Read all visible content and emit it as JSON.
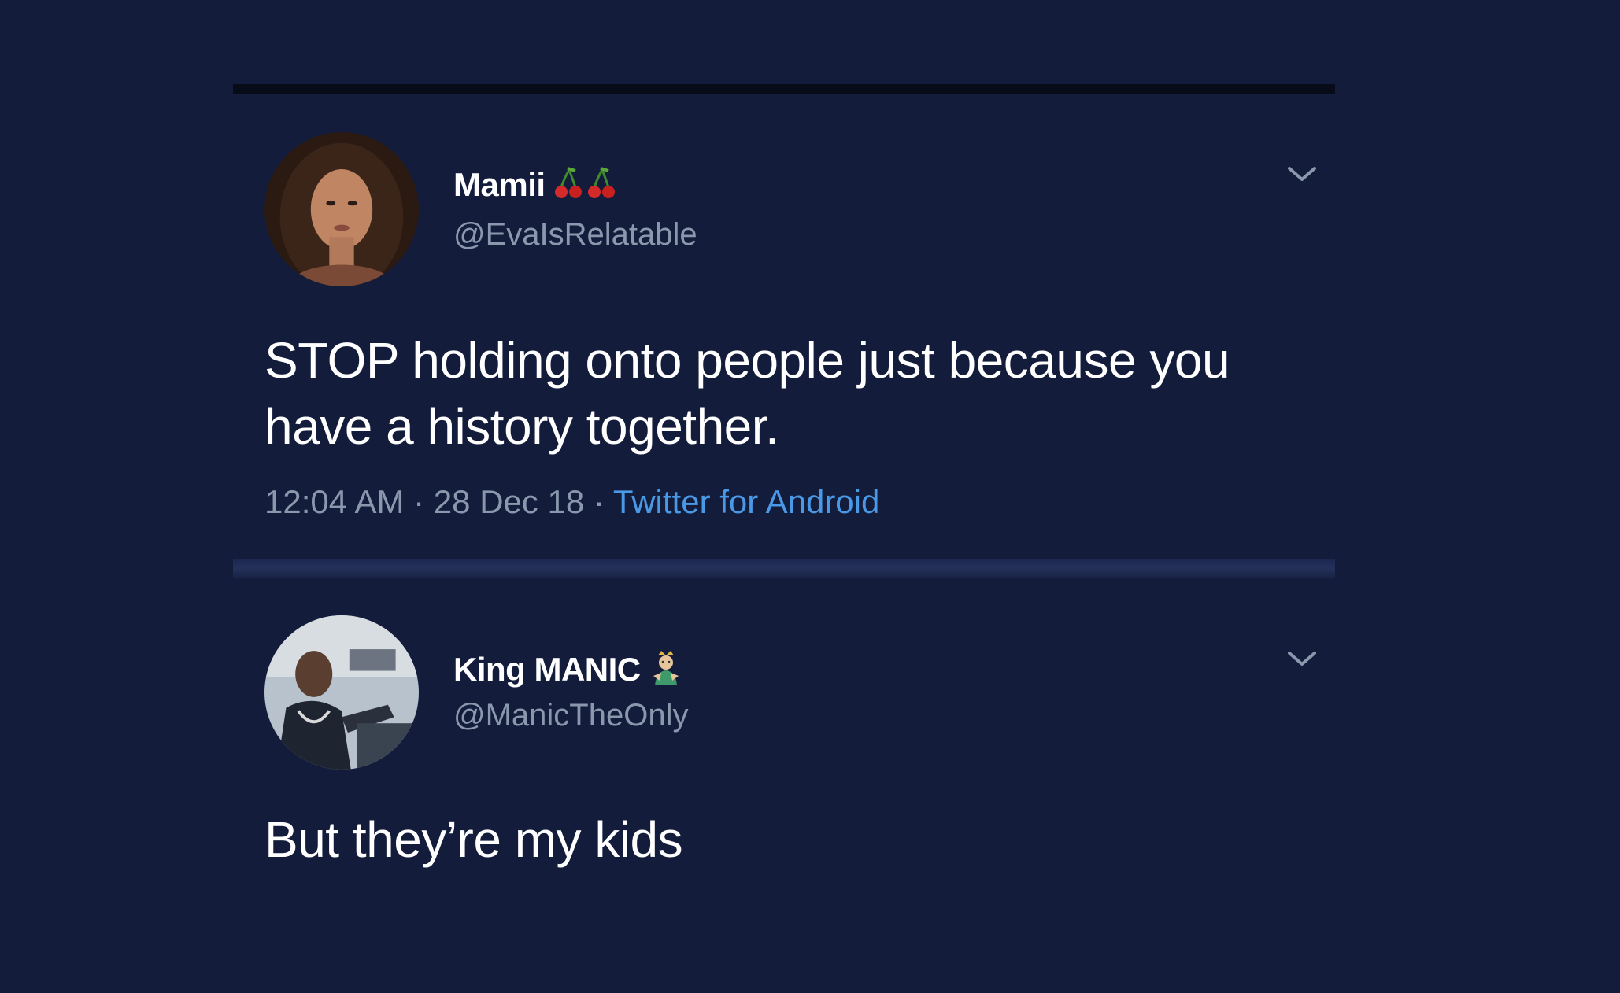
{
  "tweets": [
    {
      "display_name": "Mamii",
      "name_emoji": "cherries-icon",
      "handle": "@EvaIsRelatable",
      "text": "STOP holding onto people just because you have a history together.",
      "time": "12:04 AM",
      "date": "28 Dec 18",
      "separator": "·",
      "source": "Twitter for Android"
    },
    {
      "display_name": "King MANIC",
      "name_emoji": "genie-icon",
      "handle": "@ManicTheOnly",
      "text": "But they’re my kids"
    }
  ],
  "colors": {
    "background": "#131c3b",
    "text": "#ffffff",
    "muted": "#8a98ad",
    "link": "#4a99e6"
  }
}
